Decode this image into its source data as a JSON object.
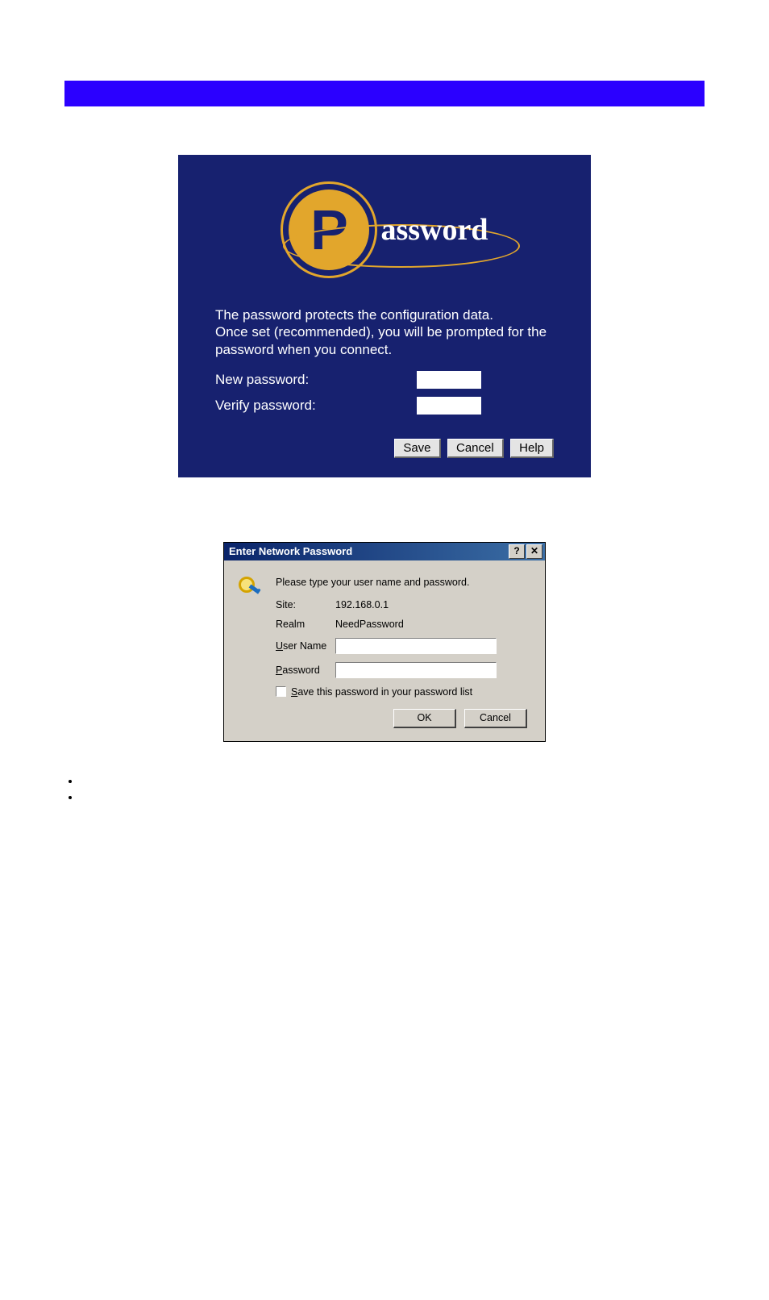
{
  "passwordPanel": {
    "logo": {
      "letter": "P",
      "text": "assword"
    },
    "description": "The password protects the configuration data.\nOnce set (recommended), you will be prompted for the password when you connect.",
    "newPasswordLabel": "New password:",
    "verifyPasswordLabel": "Verify password:",
    "newPasswordValue": "",
    "verifyPasswordValue": "",
    "buttons": {
      "save": "Save",
      "cancel": "Cancel",
      "help": "Help"
    }
  },
  "winDialog": {
    "title": "Enter Network Password",
    "helpBtn": "?",
    "closeBtn": "✕",
    "prompt": "Please type your user name and password.",
    "labels": {
      "site": "Site:",
      "realm": "Realm",
      "username": "User Name",
      "password": "Password"
    },
    "values": {
      "site": "192.168.0.1",
      "realm": "NeedPassword",
      "username": "",
      "password": ""
    },
    "saveCheckbox": "Save this password in your password list",
    "buttons": {
      "ok": "OK",
      "cancel": "Cancel"
    }
  }
}
